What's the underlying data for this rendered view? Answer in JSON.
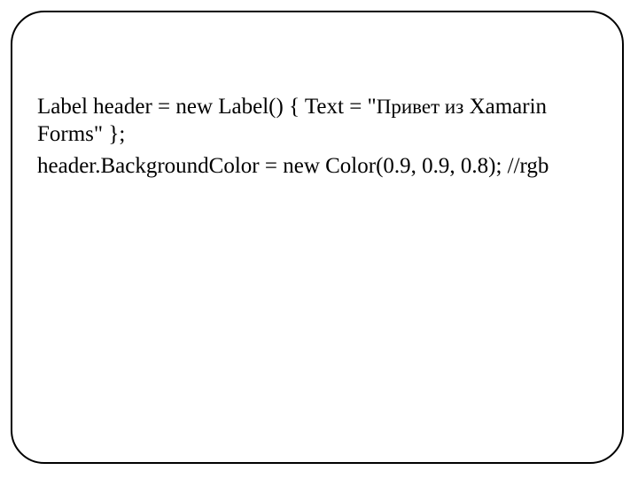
{
  "code": {
    "line1_part1": "Label header = new Label() { Text = \"",
    "line1_cyr": "Привет из",
    "line1_part2": " Xamarin Forms\" };",
    "line2": "header.BackgroundColor = new Color(0.9, 0.9, 0.8); //rgb"
  }
}
